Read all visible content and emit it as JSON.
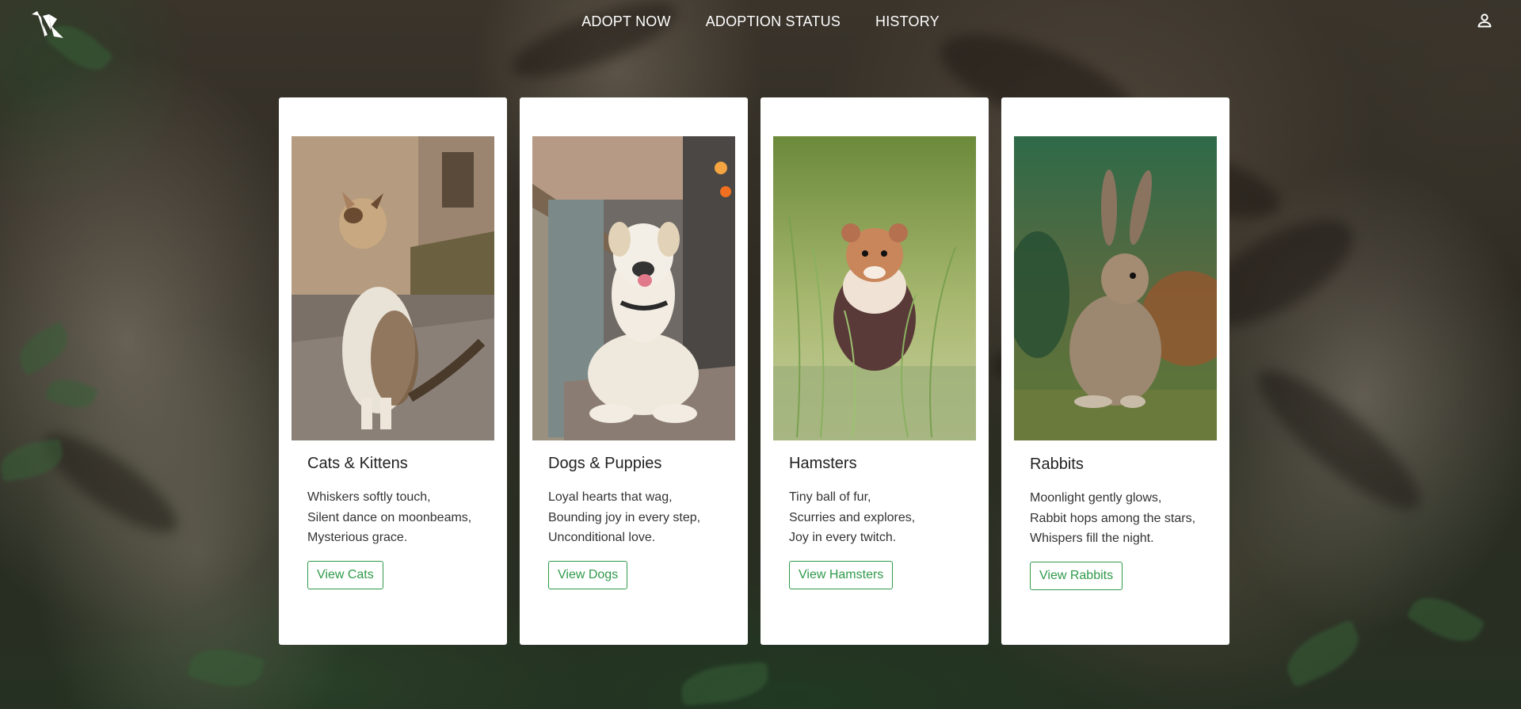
{
  "nav": {
    "logo": "origami-bird-logo",
    "links": [
      {
        "label": "ADOPT NOW"
      },
      {
        "label": "ADOPTION STATUS"
      },
      {
        "label": "HISTORY"
      }
    ],
    "account_icon": "user-icon"
  },
  "cards": [
    {
      "title": "Cats & Kittens",
      "image": "calico-cat-photo",
      "poem": [
        "Whiskers softly touch,",
        "Silent dance on moonbeams,",
        "Mysterious grace."
      ],
      "button": "View Cats"
    },
    {
      "title": "Dogs & Puppies",
      "image": "white-dog-photo",
      "poem": [
        "Loyal hearts that wag,",
        "Bounding joy in every step,",
        "Unconditional love."
      ],
      "button": "View Dogs"
    },
    {
      "title": "Hamsters",
      "image": "hamster-in-grass-photo",
      "poem": [
        "Tiny ball of fur,",
        "Scurries and explores,",
        "Joy in every twitch."
      ],
      "button": "View Hamsters"
    },
    {
      "title": "Rabbits",
      "image": "wild-rabbit-photo",
      "poem": [
        "Moonlight gently glows,",
        "Rabbit hops among the stars,",
        "Whispers fill the night."
      ],
      "button": "View Rabbits"
    }
  ],
  "colors": {
    "accent": "#2f9a4a",
    "card_bg": "#ffffff",
    "nav_text": "#ffffff"
  }
}
